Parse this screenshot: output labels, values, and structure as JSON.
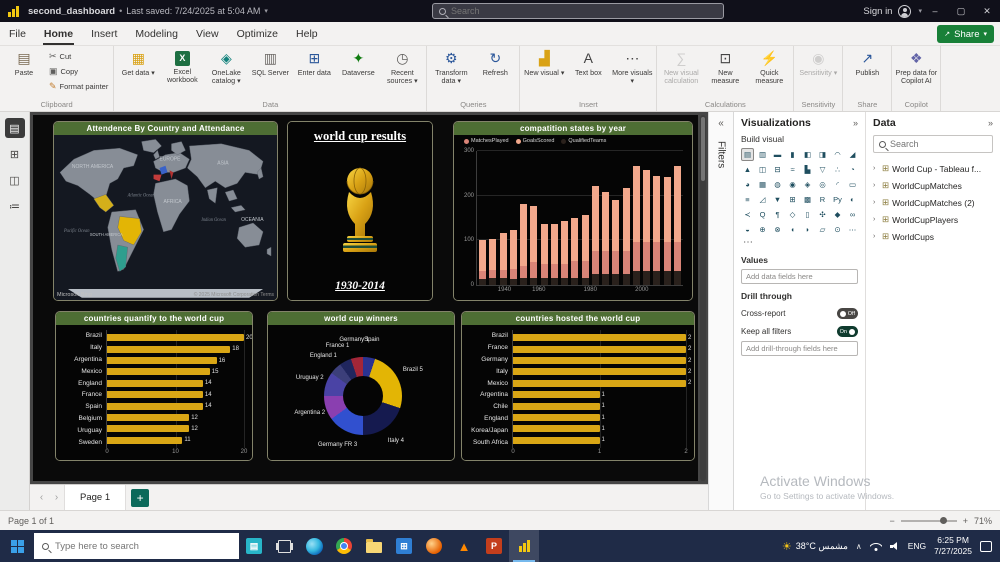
{
  "titlebar": {
    "title": "second_dashboard",
    "separator": "•",
    "saved": "Last saved: 7/24/2025 at 5:04 AM",
    "caret": "▾",
    "search_placeholder": "Search",
    "sign_in": "Sign in",
    "window_controls": [
      {
        "name": "minimize-button",
        "glyph": "–"
      },
      {
        "name": "maximize-button",
        "glyph": "▢"
      },
      {
        "name": "close-button",
        "glyph": "✕"
      }
    ]
  },
  "menubar": {
    "items": [
      "File",
      "Home",
      "Insert",
      "Modeling",
      "View",
      "Optimize",
      "Help"
    ],
    "active": "Home",
    "share_label": "Share",
    "share_icon": "↗",
    "caret": "▾"
  },
  "ribbon": {
    "caret": "▾",
    "groups": [
      {
        "label": "Clipboard",
        "items": [
          {
            "label": "Paste",
            "glyph": "▤",
            "color": "#7a6a52",
            "big": true
          },
          {
            "label": "Cut",
            "glyph": "✂",
            "color": "#5f5e5c"
          },
          {
            "label": "Copy",
            "glyph": "▣",
            "color": "#5f5e5c"
          },
          {
            "label": "Format painter",
            "glyph": "✎",
            "color": "#c27c2c"
          }
        ]
      },
      {
        "label": "Data",
        "items": [
          {
            "label": "Get data",
            "glyph": "▦",
            "color": "#d9a215",
            "big": true,
            "dropdown": true
          },
          {
            "label": "Excel workbook",
            "glyph": "X",
            "color": "#1d6f42",
            "big": true,
            "boxed": true
          },
          {
            "label": "OneLake catalog",
            "glyph": "◈",
            "color": "#12827c",
            "big": true,
            "dropdown": true
          },
          {
            "label": "SQL Server",
            "glyph": "▥",
            "color": "#6d6a67",
            "big": true
          },
          {
            "label": "Enter data",
            "glyph": "⊞",
            "color": "#2b579a",
            "big": true
          },
          {
            "label": "Dataverse",
            "glyph": "✦",
            "color": "#107c10",
            "big": true
          },
          {
            "label": "Recent sources",
            "glyph": "◷",
            "color": "#5f5e5c",
            "big": true,
            "dropdown": true
          }
        ]
      },
      {
        "label": "Queries",
        "items": [
          {
            "label": "Transform data",
            "glyph": "⚙",
            "color": "#2b579a",
            "big": true,
            "dropdown": true
          },
          {
            "label": "Refresh",
            "glyph": "↻",
            "color": "#2b579a",
            "big": true
          }
        ]
      },
      {
        "label": "Insert",
        "items": [
          {
            "label": "New visual",
            "glyph": "▟",
            "color": "#d9a215",
            "big": true,
            "dropdown": true
          },
          {
            "label": "Text box",
            "glyph": "A",
            "color": "#444444",
            "big": true
          },
          {
            "label": "More visuals",
            "glyph": "⋯",
            "color": "#444444",
            "big": true,
            "dropdown": true
          }
        ]
      },
      {
        "label": "Calculations",
        "items": [
          {
            "label": "New visual calculation",
            "glyph": "∑",
            "color": "#9a9a9a",
            "big": true,
            "disabled": true
          },
          {
            "label": "New measure",
            "glyph": "⊡",
            "color": "#444444",
            "big": true
          },
          {
            "label": "Quick measure",
            "glyph": "⚡",
            "color": "#444444",
            "big": true
          }
        ]
      },
      {
        "label": "Sensitivity",
        "items": [
          {
            "label": "Sensitivity",
            "glyph": "◉",
            "color": "#9a9a9a",
            "big": true,
            "disabled": true,
            "dropdown": true
          }
        ]
      },
      {
        "label": "Share",
        "items": [
          {
            "label": "Publish",
            "glyph": "↗",
            "color": "#2b579a",
            "big": true
          }
        ]
      },
      {
        "label": "Copilot",
        "items": [
          {
            "label": "Prep data for Copilot AI",
            "glyph": "❖",
            "color": "#6264a7",
            "big": true
          }
        ]
      }
    ]
  },
  "viewbar": {
    "items": [
      {
        "name": "report-view",
        "glyph": "▤",
        "active": true
      },
      {
        "name": "table-view",
        "glyph": "⊞"
      },
      {
        "name": "model-view",
        "glyph": "◫"
      },
      {
        "name": "tmdl-view",
        "glyph": "≔"
      }
    ]
  },
  "report": {
    "visuals": {
      "map": {
        "title": "Attendence By Country and Attendance"
      },
      "trophy": {
        "title": "world cup results",
        "subtitle": "1930-2014"
      },
      "stacked": {
        "title": "compatition states by year"
      },
      "participation": {
        "title": "countries quantify to the world cup"
      },
      "winners": {
        "title": "world cup winners"
      },
      "hosts": {
        "title": "countries hosted the world cup"
      }
    },
    "map_attribution_left": "Microsoft Bing",
    "map_attribution_right": "© 2025 Microsoft Corporation Terms"
  },
  "chart_data": [
    {
      "type": "map",
      "title": "Attendence By Country and Attendance",
      "region_labels": [
        "NORTH AMERICA",
        "EUROPE",
        "ASIA",
        "AFRICA",
        "OCEANIA",
        "SOUTH AMERICA"
      ],
      "ocean_labels": [
        "Pacific Ocean",
        "Atlantic Ocean",
        "Indian Ocean"
      ],
      "highlighted_countries": [
        {
          "name": "Brazil",
          "color": "#e3b505"
        },
        {
          "name": "Argentina",
          "color": "#2e9e8e"
        },
        {
          "name": "Mexico",
          "color": "#d4af1a"
        },
        {
          "name": "France",
          "color": "#3a62c8"
        },
        {
          "name": "Spain",
          "color": "#c23b3b"
        },
        {
          "name": "Italy",
          "color": "#b03030"
        }
      ]
    },
    {
      "type": "bar",
      "subtype": "stacked-column",
      "title": "compatition states by year",
      "x": [
        1930,
        1934,
        1938,
        1950,
        1954,
        1958,
        1962,
        1966,
        1970,
        1974,
        1978,
        1982,
        1986,
        1990,
        1994,
        1998,
        2002,
        2006,
        2010,
        2014
      ],
      "series": [
        {
          "name": "MatchesPlayed",
          "color": "#d98477",
          "values": [
            18,
            17,
            18,
            22,
            26,
            35,
            32,
            32,
            32,
            38,
            38,
            52,
            52,
            52,
            52,
            64,
            64,
            64,
            64,
            64
          ]
        },
        {
          "name": "GoalsScored",
          "color": "#f2a88c",
          "values": [
            70,
            70,
            84,
            88,
            140,
            126,
            89,
            89,
            95,
            97,
            102,
            146,
            132,
            115,
            141,
            171,
            161,
            147,
            145,
            171
          ]
        },
        {
          "name": "QualifiedTeams",
          "color": "#2a211c",
          "values": [
            13,
            16,
            15,
            13,
            16,
            16,
            16,
            16,
            16,
            16,
            16,
            24,
            24,
            24,
            24,
            32,
            32,
            32,
            32,
            32
          ]
        }
      ],
      "stack_order_bottom_to_top": [
        "QualifiedTeams",
        "MatchesPlayed",
        "GoalsScored"
      ],
      "ylim": [
        0,
        300
      ],
      "yticks": [
        0,
        100,
        200,
        300
      ],
      "xticks": [
        1940,
        1960,
        1980,
        2000
      ],
      "legend_position": "top",
      "grid": true
    },
    {
      "type": "bar",
      "subtype": "horizontal",
      "title": "countries quantify to the world cup",
      "categories": [
        "Brazil",
        "Italy",
        "Argentina",
        "Mexico",
        "England",
        "France",
        "Spain",
        "Belgium",
        "Uruguay",
        "Sweden"
      ],
      "values": [
        20,
        18,
        16,
        15,
        14,
        14,
        14,
        12,
        12,
        11
      ],
      "bar_color": "#d9a615",
      "xlim": [
        0,
        20
      ],
      "xticks": [
        0,
        10,
        20
      ]
    },
    {
      "type": "pie",
      "subtype": "donut",
      "title": "world cup winners",
      "slices": [
        {
          "label": "Spain",
          "value": 1,
          "color": "#2b3390"
        },
        {
          "label": "Brazil 5",
          "value": 5,
          "color": "#e3b505"
        },
        {
          "label": "Italy 4",
          "value": 4,
          "color": "#151a4f"
        },
        {
          "label": "Germany FR 3",
          "value": 3,
          "color": "#3150cf"
        },
        {
          "label": "Argentina 2",
          "value": 2,
          "color": "#8a3fb0"
        },
        {
          "label": "Uruguay 2",
          "value": 2,
          "color": "#4a43a5"
        },
        {
          "label": "England 1",
          "value": 1,
          "color": "#3c3f7a"
        },
        {
          "label": "France 1",
          "value": 1,
          "color": "#20265e"
        },
        {
          "label": "Germany 1",
          "value": 1,
          "color": "#a32638"
        }
      ]
    },
    {
      "type": "bar",
      "subtype": "horizontal",
      "title": "countries hosted the world cup",
      "categories": [
        "Brazil",
        "France",
        "Germany",
        "Italy",
        "Mexico",
        "Argentina",
        "Chile",
        "England",
        "Korea/Japan",
        "South Africa"
      ],
      "values": [
        2,
        2,
        2,
        2,
        2,
        1,
        1,
        1,
        1,
        1
      ],
      "bar_color": "#d9a615",
      "xlim": [
        0,
        2
      ],
      "xticks": [
        0,
        1,
        2
      ]
    }
  ],
  "filters_panel": {
    "title": "Filters",
    "expand_glyph": "«"
  },
  "viz_panel": {
    "title": "Visualizations",
    "collapse_glyph": "»",
    "subtitle": "Build visual",
    "more_glyph": "⋯",
    "icons": [
      [
        "stacked-bar-chart",
        "▤"
      ],
      [
        "stacked-column-chart",
        "▥"
      ],
      [
        "clustered-bar-chart",
        "▬"
      ],
      [
        "clustered-column-chart",
        "▮"
      ],
      [
        "100-stacked-bar-chart",
        "◧"
      ],
      [
        "100-stacked-column-chart",
        "◨"
      ],
      [
        "line-chart",
        "◠"
      ],
      [
        "area-chart",
        "◢"
      ],
      [
        "stacked-area-chart",
        "▲"
      ],
      [
        "line-and-stacked-column-chart",
        "◫"
      ],
      [
        "line-and-clustered-column-chart",
        "⊟"
      ],
      [
        "ribbon-chart",
        "≈"
      ],
      [
        "waterfall-chart",
        "▙"
      ],
      [
        "funnel-chart",
        "▽"
      ],
      [
        "scatter-chart",
        "∴"
      ],
      [
        "pie-chart",
        "◔"
      ],
      [
        "donut-chart",
        "◕"
      ],
      [
        "treemap",
        "▦"
      ],
      [
        "map",
        "◍"
      ],
      [
        "filled-map",
        "◉"
      ],
      [
        "shape-map",
        "◈"
      ],
      [
        "azure-map",
        "◎"
      ],
      [
        "gauge",
        "◜"
      ],
      [
        "card",
        "▭"
      ],
      [
        "multi-row-card",
        "≡"
      ],
      [
        "kpi",
        "◿"
      ],
      [
        "slicer",
        "▼"
      ],
      [
        "table",
        "⊞"
      ],
      [
        "matrix",
        "▩"
      ],
      [
        "r-script-visual",
        "R"
      ],
      [
        "python-visual",
        "Py"
      ],
      [
        "key-influencers",
        "◐"
      ],
      [
        "decomposition-tree",
        "≺"
      ],
      [
        "qa-visual",
        "Q"
      ],
      [
        "narrative",
        "¶"
      ],
      [
        "metrics",
        "◇"
      ],
      [
        "paginated-report",
        "▯"
      ],
      [
        "arcgis-map",
        "✣"
      ],
      [
        "power-apps",
        "◆"
      ],
      [
        "power-automate",
        "∞"
      ],
      [
        "visual-41",
        "◒"
      ],
      [
        "visual-42",
        "⊕"
      ],
      [
        "visual-43",
        "⊗"
      ],
      [
        "visual-44",
        "◖"
      ],
      [
        "visual-45",
        "◗"
      ],
      [
        "visual-46",
        "▱"
      ],
      [
        "visual-47",
        "⊙"
      ],
      [
        "visual-48",
        "⋯"
      ]
    ],
    "values_label": "Values",
    "values_placeholder": "Add data fields here",
    "drill_label": "Drill through",
    "cross_report": {
      "label": "Cross-report",
      "state": "Off"
    },
    "keep_filters": {
      "label": "Keep all filters",
      "state": "On"
    },
    "drill_placeholder": "Add drill-through fields here"
  },
  "data_panel": {
    "title": "Data",
    "collapse_glyph": "»",
    "search_placeholder": "Search",
    "field_chevron": "›",
    "table_icon": "⊞",
    "fields": [
      "World Cup - Tableau f...",
      "WorldCupMatches",
      "WorldCupMatches (2)",
      "WorldCupPlayers",
      "WorldCups"
    ]
  },
  "pagebar": {
    "prev": "‹",
    "next": "›",
    "page_tab": "Page 1",
    "add_label": "+"
  },
  "statusbar": {
    "page_info": "Page 1 of 1",
    "zoom_out": "−",
    "zoom_in": "+",
    "zoom": "71%"
  },
  "watermark": {
    "line1": "Activate Windows",
    "line2": "Go to Settings to activate Windows."
  },
  "taskbar": {
    "search_placeholder": "Type here to search",
    "weather_icon": "☀",
    "weather": "38°C مشمس",
    "tray_chevron": "∧",
    "lang": "ENG",
    "time": "6:25 PM",
    "date": "7/27/2025",
    "apps": [
      {
        "name": "widgets-icon",
        "kind": "square",
        "color": "#28b5c8",
        "glyph": "▤"
      },
      {
        "name": "task-view-icon",
        "kind": "taskview"
      },
      {
        "name": "edge-icon",
        "kind": "edge"
      },
      {
        "name": "chrome-icon",
        "kind": "chrome"
      },
      {
        "name": "file-explorer-icon",
        "kind": "folder"
      },
      {
        "name": "store-icon",
        "kind": "square",
        "color": "#2f7fd4",
        "glyph": "⊞"
      },
      {
        "name": "firefox-icon",
        "kind": "circle",
        "color": "#e66000"
      },
      {
        "name": "vlc-icon",
        "kind": "glyph",
        "color": "#ff8800",
        "glyph": "▲"
      },
      {
        "name": "powerpoint-icon",
        "kind": "square",
        "color": "#c43e1c",
        "glyph": "P"
      },
      {
        "name": "powerbi-icon",
        "kind": "powerbi",
        "active": true
      }
    ]
  }
}
